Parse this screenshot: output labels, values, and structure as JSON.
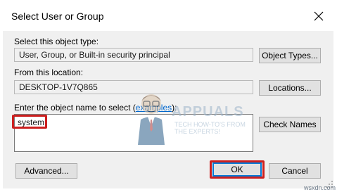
{
  "dialog": {
    "title": "Select User or Group",
    "object_type_label": "Select this object type:",
    "object_type_value": "User, Group, or Built-in security principal",
    "object_types_button": "Object Types...",
    "location_label": "From this location:",
    "location_value": "DESKTOP-1V7Q865",
    "locations_button": "Locations...",
    "enter_name_label": "Enter the object name to select (",
    "examples_link": "examples",
    "enter_name_suffix": "):",
    "name_input_value": "system",
    "check_names_button": "Check Names",
    "advanced_button": "Advanced...",
    "ok_button": "OK",
    "cancel_button": "Cancel"
  },
  "watermark": {
    "brand": "APPUALS",
    "tagline_1": "TECH HOW-TO'S FROM",
    "tagline_2": "THE EXPERTS!"
  },
  "credit": "wsxdn.com",
  "colors": {
    "highlight": "#cc1f1f",
    "dialog_bg": "#f0f0f0",
    "link": "#0066cc",
    "default_button_border": "#0078d7"
  }
}
